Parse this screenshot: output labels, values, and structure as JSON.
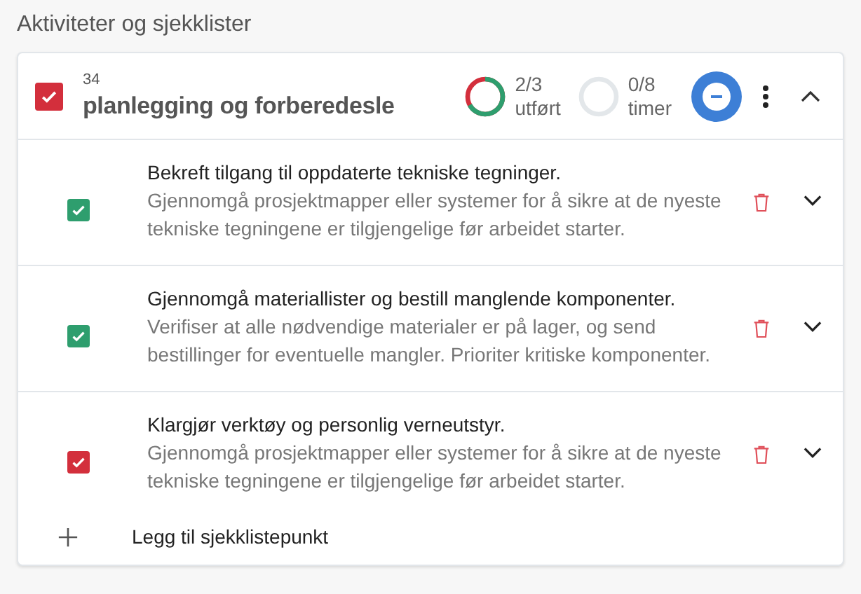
{
  "section_title": "Aktiviteter og sjekklister",
  "activity": {
    "checked": true,
    "color": "#d32f3c",
    "number": "34",
    "title": "planlegging og forberedesle",
    "expanded": true,
    "progress": {
      "level": 0.667,
      "value": "2/3",
      "label": "utført"
    },
    "hours": {
      "value": "0/8",
      "label": "timer"
    }
  },
  "items": [
    {
      "checked": true,
      "color": "#2e9e6e",
      "title": "Bekreft tilgang til oppdaterte tekniske tegninger.",
      "description": "Gjennomgå prosjektmapper eller systemer for å sikre at de nyeste tekniske tegningene er tilgjengelige før arbeidet starter."
    },
    {
      "checked": true,
      "color": "#2e9e6e",
      "title": "Gjennomgå materiallister og bestill manglende komponenter.",
      "description": "Verifiser at alle nødvendige materialer er på lager, og send bestillinger for eventuelle mangler. Prioriter kritiske komponenter."
    },
    {
      "checked": true,
      "color": "#d32f3c",
      "title": "Klargjør verktøy og personlig verneutstyr.",
      "description": "Gjennomgå prosjektmapper eller systemer for å sikre at de nyeste tekniske tegningene er tilgjengelige før arbeidet starter."
    }
  ],
  "add_label": "Legg til sjekklistepunkt"
}
